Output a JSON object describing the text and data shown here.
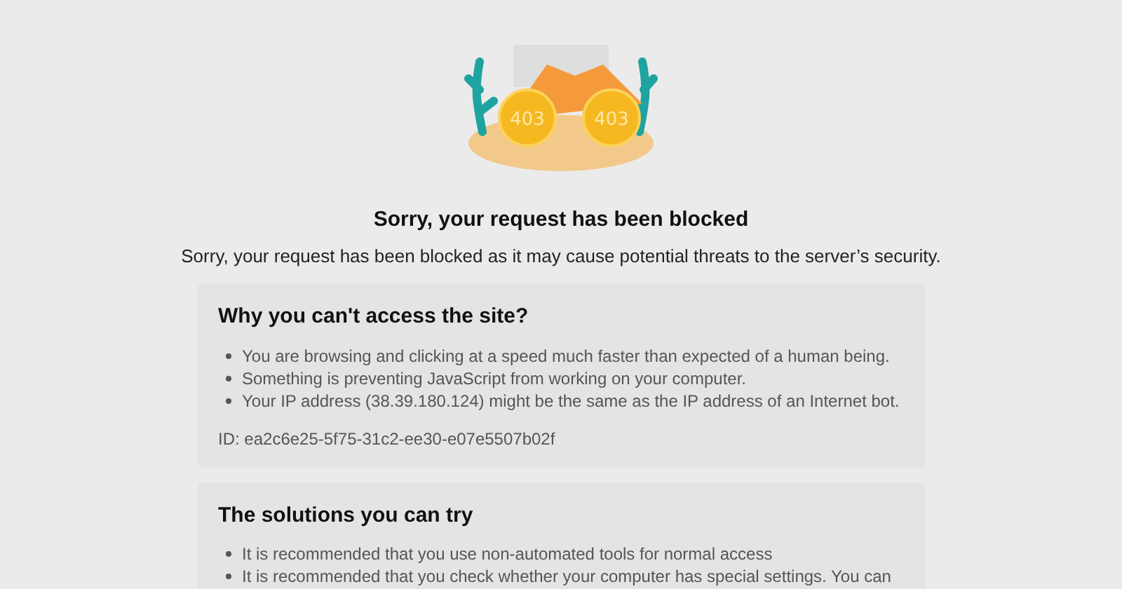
{
  "illustration": {
    "lens_labels": [
      "403",
      "403"
    ]
  },
  "title": "Sorry, your request has been blocked",
  "message": "Sorry, your request has been blocked as it may cause potential threats to the server’s security.",
  "cards": [
    {
      "heading": "Why you can't access the site?",
      "items": [
        "You are browsing and clicking at a speed much faster than expected of a human being.",
        "Something is preventing JavaScript from working on your computer.",
        "Your IP address (38.39.180.124) might be the same as the IP address of an Internet bot."
      ],
      "footer": "ID: ea2c6e25-5f75-31c2-ee30-e07e5507b02f"
    },
    {
      "heading": "The solutions you can try",
      "items": [
        "It is recommended that you use non-automated tools for normal access",
        "It is recommended that you check whether your computer has special settings. You can"
      ]
    }
  ]
}
